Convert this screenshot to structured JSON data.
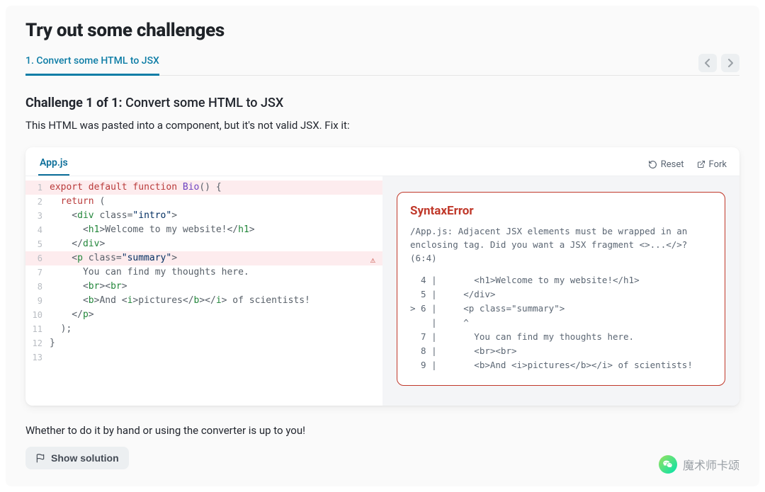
{
  "heading": "Try out some challenges",
  "tab_label": "1. Convert some HTML to JSX",
  "challenge_prefix": "Challenge 1 of 1:",
  "challenge_name": " Convert some HTML to JSX",
  "description": "This HTML was pasted into a component, but it's not valid JSX. Fix it:",
  "sandbox": {
    "file_tab": "App.js",
    "reset_label": "Reset",
    "fork_label": "Fork"
  },
  "code_lines": {
    "l1_a": "export",
    "l1_b": " default",
    "l1_c": " function",
    "l1_d": " Bio",
    "l1_e": "() {",
    "l2_a": "  ",
    "l2_b": "return",
    "l2_c": " (",
    "l3_a": "    <",
    "l3_b": "div",
    "l3_c": " class=",
    "l3_d": "\"intro\"",
    "l3_e": ">",
    "l4_a": "      <",
    "l4_b": "h1",
    "l4_c": ">Welcome to my website!</",
    "l4_d": "h1",
    "l4_e": ">",
    "l5_a": "    </",
    "l5_b": "div",
    "l5_c": ">",
    "l6_a": "    <",
    "l6_b": "p",
    "l6_c": " class=",
    "l6_d": "\"summary\"",
    "l6_e": ">",
    "l7": "      You can find my thoughts here.",
    "l8_a": "      <",
    "l8_b": "br",
    "l8_c": "><",
    "l8_d": "br",
    "l8_e": ">",
    "l9_a": "      <",
    "l9_b": "b",
    "l9_c": ">And <",
    "l9_d": "i",
    "l9_e": ">pictures</",
    "l9_f": "b",
    "l9_g": "></",
    "l9_h": "i",
    "l9_i": "> of scientists!",
    "l10_a": "    </",
    "l10_b": "p",
    "l10_c": ">",
    "l11": "  );",
    "l12": "}",
    "l13": ""
  },
  "gutters": {
    "n1": "1",
    "n2": "2",
    "n3": "3",
    "n4": "4",
    "n5": "5",
    "n6": "6",
    "n7": "7",
    "n8": "8",
    "n9": "9",
    "n10": "10",
    "n11": "11",
    "n12": "12",
    "n13": "13"
  },
  "error": {
    "title": "SyntaxError",
    "message": "/App.js: Adjacent JSX elements must be wrapped in an enclosing tag. Did you want a JSX fragment <>...</>? (6:4)",
    "trace": "  4 |       <h1>Welcome to my website!</h1>\n  5 |     </div>\n> 6 |     <p class=\"summary\">\n    |     ^\n  7 |       You can find my thoughts here.\n  8 |       <br><br>\n  9 |       <b>And <i>pictures</b></i> of scientists!"
  },
  "bottom_text": "Whether to do it by hand or using the converter is up to you!",
  "solution_label": "Show solution",
  "watermark_text": "魔术师卡颂"
}
